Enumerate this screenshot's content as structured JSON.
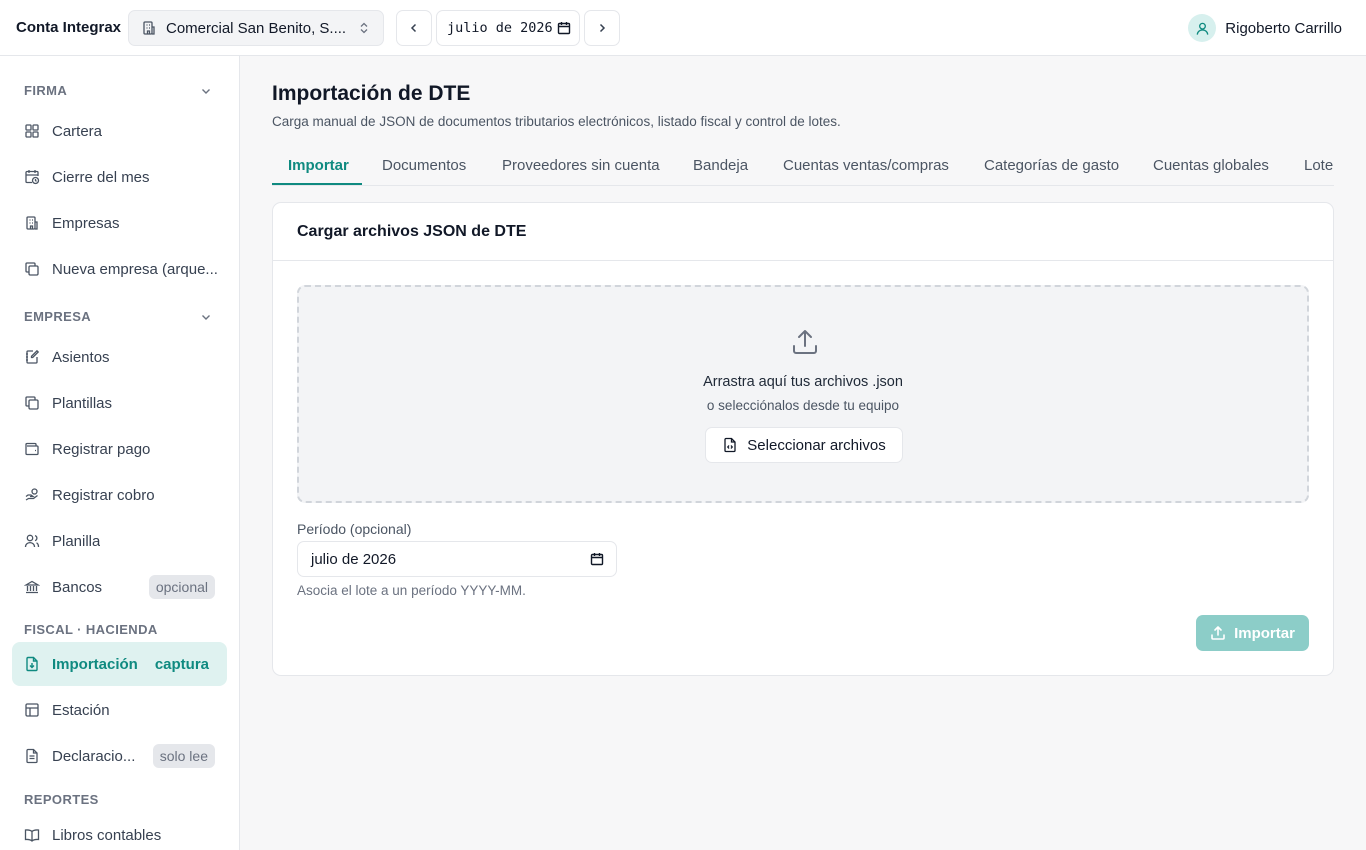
{
  "app": {
    "brand": "Conta Integrax"
  },
  "topbar": {
    "company": "Comercial San Benito, S....",
    "period": "julio de 2026",
    "user_name": "Rigoberto Carrillo"
  },
  "sidebar": {
    "sections": {
      "firma": "FIRMA",
      "empresa": "EMPRESA",
      "fiscal": "FISCAL · HACIENDA",
      "reportes": "REPORTES"
    },
    "items": {
      "cartera": "Cartera",
      "cierre": "Cierre del mes",
      "empresas": "Empresas",
      "nueva_empresa": "Nueva empresa (arque...",
      "asientos": "Asientos",
      "plantillas": "Plantillas",
      "registrar_pago": "Registrar pago",
      "registrar_cobro": "Registrar cobro",
      "planilla": "Planilla",
      "bancos": "Bancos",
      "bancos_badge": "opcional",
      "importacion": "Importación",
      "importacion_badge": "captura",
      "estacion": "Estación",
      "declaraciones": "Declaracio...",
      "declaraciones_badge": "solo lee",
      "libros": "Libros contables"
    }
  },
  "main": {
    "title": "Importación de DTE",
    "subtitle": "Carga manual de JSON de documentos tributarios electrónicos, listado fiscal y control de lotes.",
    "tabs": {
      "importar": "Importar",
      "documentos": "Documentos",
      "proveedores": "Proveedores sin cuenta",
      "bandeja": "Bandeja",
      "cuentas_vc": "Cuentas ventas/compras",
      "categorias": "Categorías de gasto",
      "cuentas_globales": "Cuentas globales",
      "lotes": "Lote"
    },
    "card": {
      "title": "Cargar archivos JSON de DTE",
      "drop_main": "Arrastra aquí tus archivos .json",
      "drop_sub": "o selecciónalos desde tu equipo",
      "select_button": "Seleccionar archivos",
      "period_label": "Período (opcional)",
      "period_value": "julio de 2026",
      "period_help": "Asocia el lote a un período YYYY-MM.",
      "import_button": "Importar"
    }
  },
  "colors": {
    "accent": "#0f8a80",
    "accent_soft": "#dff2f0",
    "import_button_disabled": "#8ccdc8"
  }
}
